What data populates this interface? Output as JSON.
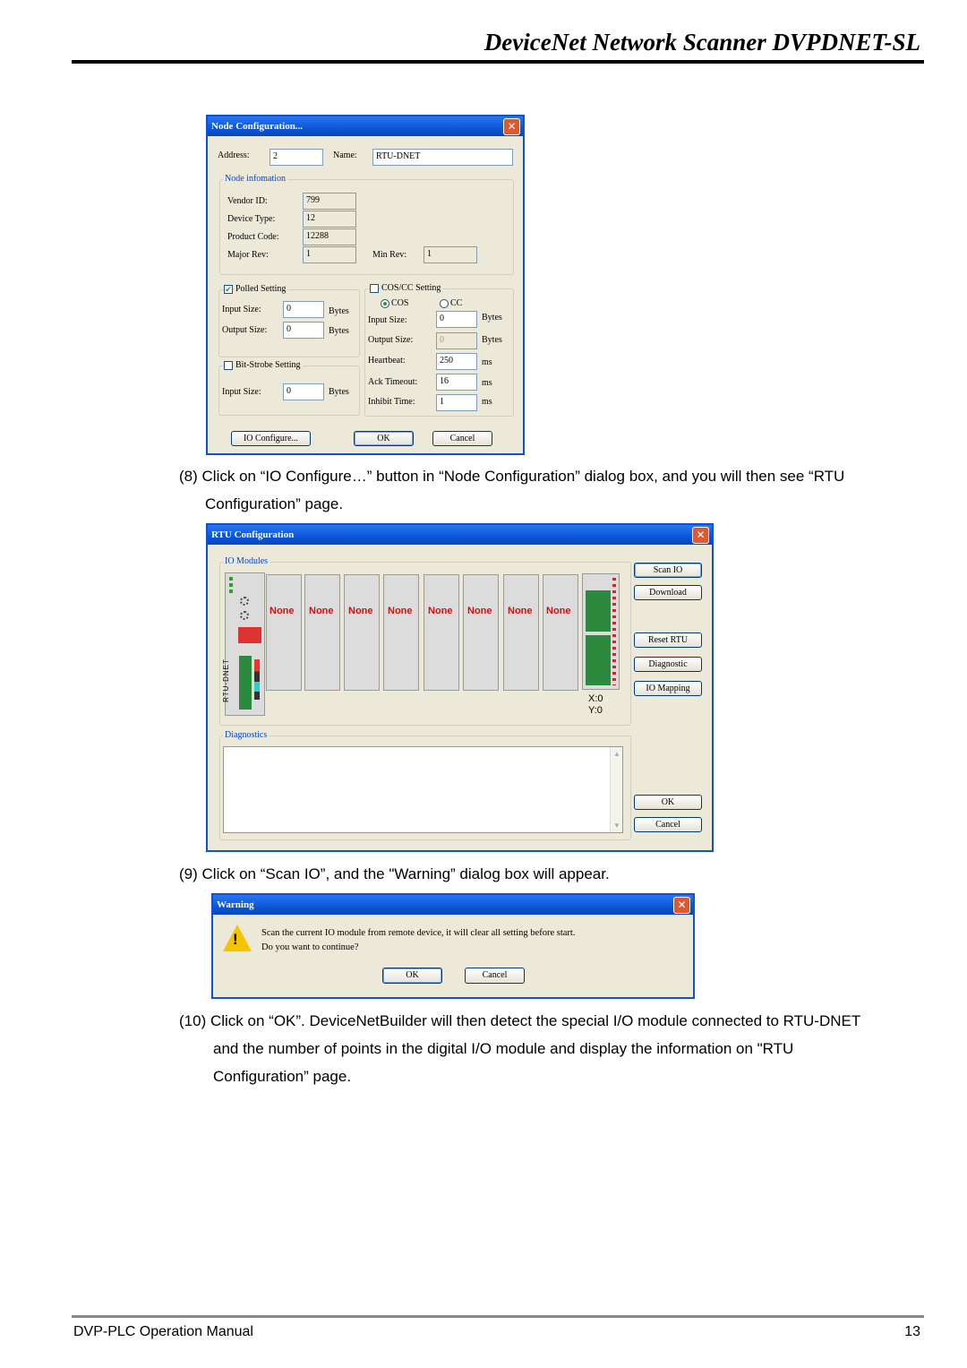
{
  "header": {
    "title": "DeviceNet Network Scanner DVPDNET-SL"
  },
  "node_dialog": {
    "title": "Node Configuration...",
    "address_label": "Address:",
    "address_value": "2",
    "name_label": "Name:",
    "name_value": "RTU-DNET",
    "node_info_title": "Node infomation",
    "vendor_label": "Vendor ID:",
    "vendor_value": "799",
    "device_type_label": "Device Type:",
    "device_type_value": "12",
    "product_code_label": "Product Code:",
    "product_code_value": "12288",
    "major_rev_label": "Major Rev:",
    "major_rev_value": "1",
    "min_rev_label": "Min Rev:",
    "min_rev_value": "1",
    "polled_label": "Polled Setting",
    "input_size_label": "Input Size:",
    "polled_input_value": "0",
    "output_size_label": "Output Size:",
    "polled_output_value": "0",
    "bytes_label": "Bytes",
    "bitstrobe_label": "Bit-Strobe Setting",
    "bitstrobe_input_value": "0",
    "cos_cc_label": "COS/CC Setting",
    "cos_label": "COS",
    "cc_label": "CC",
    "cos_input_value": "0",
    "cos_output_value": "0",
    "heartbeat_label": "Heartbeat:",
    "heartbeat_value": "250",
    "ack_timeout_label": "Ack Timeout:",
    "ack_timeout_value": "16",
    "inhibit_label": "Inhibit Time:",
    "inhibit_value": "1",
    "ms_label": "ms",
    "io_configure_button": "IO Configure...",
    "ok_button": "OK",
    "cancel_button": "Cancel"
  },
  "step8": {
    "number": "(8)",
    "line1": "Click on “IO Configure…” button in “Node Configuration” dialog box, and you will then see “RTU",
    "line2": "Configuration” page."
  },
  "rtu_dialog": {
    "title": "RTU Configuration",
    "io_modules_title": "IO Modules",
    "rtu_vertical_label": "RTU-DNET",
    "slots": [
      "None",
      "None",
      "None",
      "None",
      "None",
      "None",
      "None",
      "None"
    ],
    "x_readout": "X:0",
    "y_readout": "Y:0",
    "diagnostics_title": "Diagnostics",
    "buttons": {
      "scan_io": "Scan IO",
      "download": "Download",
      "reset_rtu": "Reset RTU",
      "diagnostic": "Diagnostic",
      "io_mapping": "IO Mapping",
      "ok": "OK",
      "cancel": "Cancel"
    }
  },
  "step9": {
    "number": "(9)",
    "line1": "Click on “Scan IO”, and the \"Warning” dialog box will appear."
  },
  "warning_dialog": {
    "title": "Warning",
    "message_line1": "Scan the current IO module from remote device, it will clear all setting before start.",
    "message_line2": "Do you want to continue?",
    "ok_button": "OK",
    "cancel_button": "Cancel"
  },
  "step10": {
    "number": "(10)",
    "line1": "Click on “OK”. DeviceNetBuilder will then detect the special I/O module connected to RTU-DNET",
    "line2": "and the number of points in the digital I/O module and display the information on \"RTU",
    "line3": "Configuration” page."
  },
  "footer": {
    "left": "DVP-PLC Operation Manual",
    "page": "13"
  }
}
